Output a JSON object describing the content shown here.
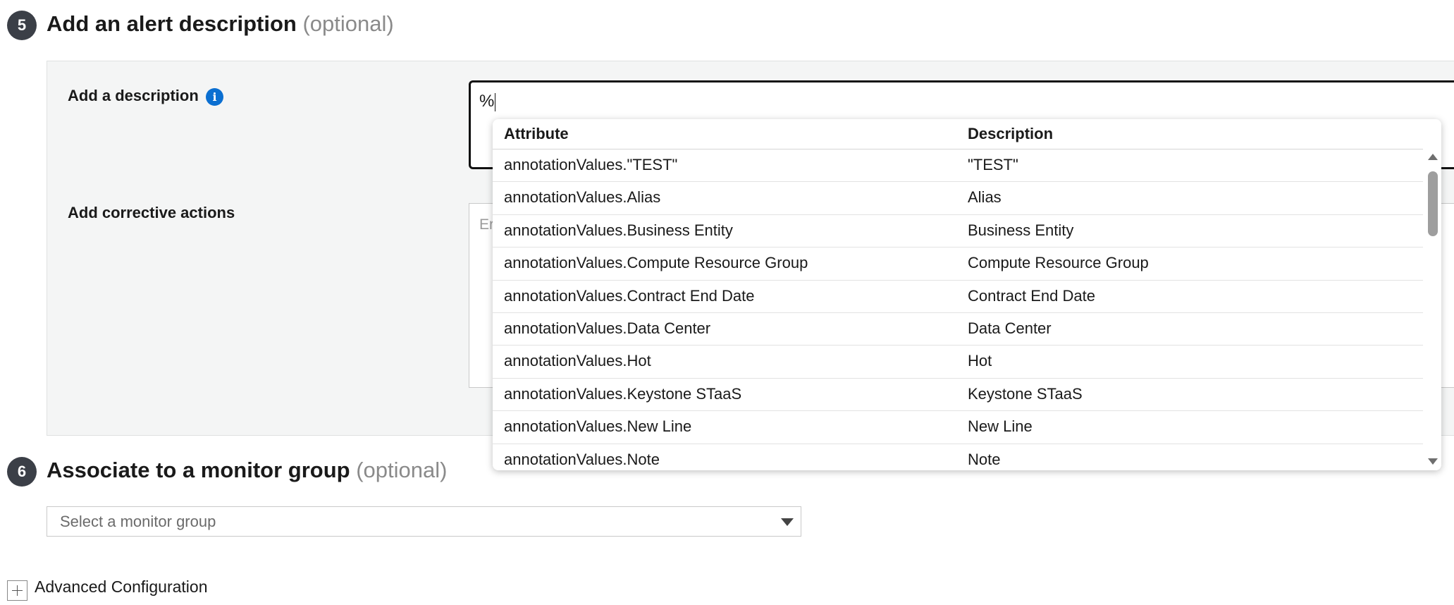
{
  "step5": {
    "number": "5",
    "title": "Add an alert description",
    "optional": "(optional)"
  },
  "description": {
    "label": "Add a description",
    "info_icon": "info-icon",
    "value": "%"
  },
  "corrective": {
    "label": "Add corrective actions",
    "placeholder_visible": "Er"
  },
  "autocomplete": {
    "headers": {
      "attribute": "Attribute",
      "description": "Description"
    },
    "rows": [
      {
        "attribute": "annotationValues.\"TEST\"",
        "description": "\"TEST\""
      },
      {
        "attribute": "annotationValues.Alias",
        "description": "Alias"
      },
      {
        "attribute": "annotationValues.Business Entity",
        "description": "Business Entity"
      },
      {
        "attribute": "annotationValues.Compute Resource Group",
        "description": "Compute Resource Group"
      },
      {
        "attribute": "annotationValues.Contract End Date",
        "description": "Contract End Date"
      },
      {
        "attribute": "annotationValues.Data Center",
        "description": "Data Center"
      },
      {
        "attribute": "annotationValues.Hot",
        "description": "Hot"
      },
      {
        "attribute": "annotationValues.Keystone STaaS",
        "description": "Keystone STaaS"
      },
      {
        "attribute": "annotationValues.New Line",
        "description": "New Line"
      },
      {
        "attribute": "annotationValues.Note",
        "description": "Note"
      }
    ]
  },
  "step6": {
    "number": "6",
    "title": "Associate to a monitor group",
    "optional": "(optional)"
  },
  "monitor_group": {
    "placeholder": "Select a monitor group"
  },
  "advanced": {
    "label": "Advanced Configuration",
    "icon": "plus-icon"
  },
  "colors": {
    "badge": "#3b3f47",
    "info_icon": "#0b6fd1",
    "panel_bg": "#f4f5f5",
    "optional_text": "#8a8a8a"
  }
}
